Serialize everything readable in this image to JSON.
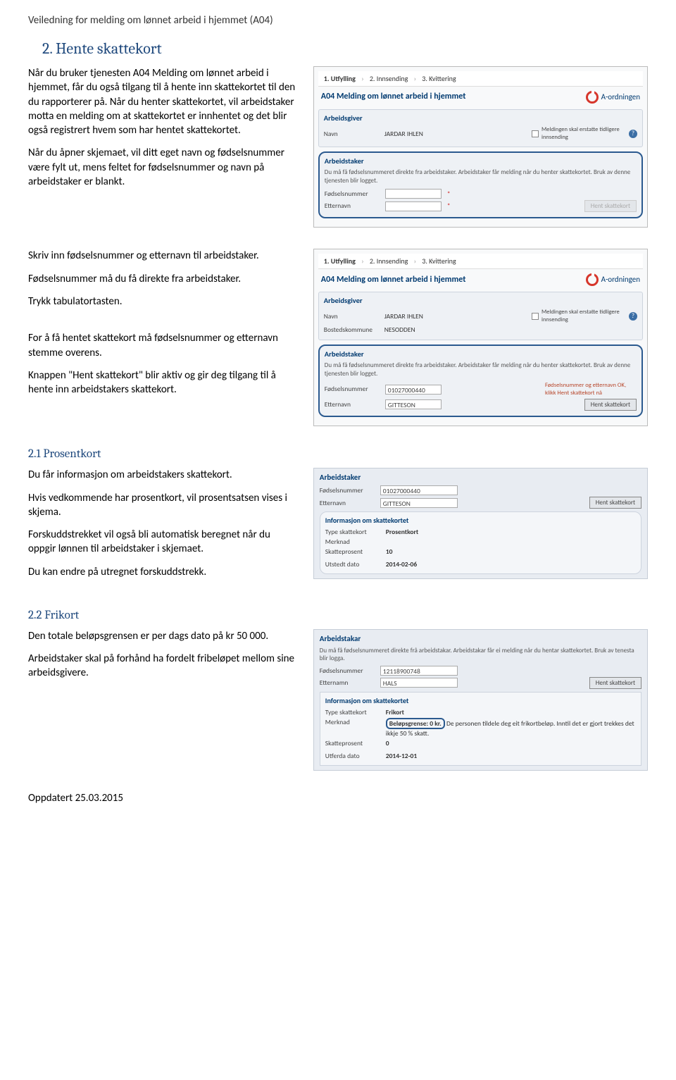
{
  "doc": {
    "title": "Veiledning for melding om lønnet arbeid i hjemmet (A04)",
    "footer": "Oppdatert 25.03.2015"
  },
  "section2": {
    "heading": "2. Hente skattekort",
    "p1": "Når du bruker tjenesten A04 Melding om lønnet arbeid i hjemmet, får du også tilgang til å hente inn skattekortet til den du rapporterer på. Når du henter skattekortet, vil arbeidstaker motta en melding om at skattekortet er innhentet og det blir også registrert hvem som har hentet skattekortet.",
    "p2": "Når du åpner skjemaet, vil ditt eget navn og fødselsnummer være fylt ut, mens feltet for fødselsnummer og navn på arbeidstaker er blankt.",
    "p3a": "Skriv inn fødselsnummer og etternavn til arbeidstaker.",
    "p3b": "Fødselsnummer må du få direkte fra arbeidstaker.",
    "p3c": "Trykk tabulatortasten.",
    "p4a": "For å få hentet skattekort må fødselsnummer og etternavn stemme overens.",
    "p4b": "Knappen \"Hent skattekort\" blir aktiv og gir deg tilgang til å hente inn arbeidstakers skattekort."
  },
  "section21": {
    "heading": "2.1 Prosentkort",
    "p1": "Du får informasjon om arbeidstakers skattekort.",
    "p2": "Hvis vedkommende har prosentkort, vil prosentsatsen vises i skjema.",
    "p3": "Forskuddstrekket vil også bli automatisk beregnet når du oppgir lønnen til arbeidstaker i skjemaet.",
    "p4": "Du kan endre på utregnet forskuddstrekk."
  },
  "section22": {
    "heading": "2.2 Frikort",
    "p1": "Den totale beløpsgrensen er per dags dato på kr 50 000.",
    "p2": "Arbeidstaker skal på forhånd ha fordelt fribeløpet mellom sine arbeidsgivere."
  },
  "shot": {
    "steps": {
      "s1": "1. Utfylling",
      "s2": "2. Innsending",
      "s3": "3. Kvittering"
    },
    "form_title": "A04 Melding om lønnet arbeid i hjemmet",
    "brand": "A-ordningen",
    "arbeidsgiver": "Arbeidsgiver",
    "arbeidstaker": "Arbeidstaker",
    "arbeidstakar_nn": "Arbeidstakar",
    "navn": "Navn",
    "bosted": "Bostedskommune",
    "navn_val": "JARDAR IHLEN",
    "bosted_val": "NESODDEN",
    "checkbox_label": "Meldingen skal erstatte tidligere innsending",
    "note_text": "Du må få fødselsnummeret direkte fra arbeidstaker. Arbeidstaker får melding når du henter skattekortet. Bruk av denne tjenesten blir logget.",
    "note_text_nn": "Du må få fødselsnummeret direkte frå arbeidstakar. Arbeidstakar får ei melding når du hentar skattekortet. Bruk av tenesta blir logga.",
    "fnr": "Fødselsnummer",
    "etternavn": "Etternavn",
    "etternamn_nn": "Etternamn",
    "hent_btn": "Hent skattekort",
    "ok_note": "Fødselsnummer og etternavn OK, klikk Hent skattekort nå",
    "fnr_val": "01027000440",
    "ett_val": "GITTESON",
    "info_title": "Informasjon om skattekortet",
    "type_label": "Type skattekort",
    "type_prosent": "Prosentkort",
    "type_frikort": "Frikort",
    "merknad": "Merknad",
    "skatteprosent": "Skatteprosent",
    "prosent_val": "10",
    "utstedt": "Utstedt dato",
    "utstedt_val": "2014-02-06",
    "frikort_fnr": "12118900748",
    "frikort_ett": "HALS",
    "frikort_merknad_lead": "Beløpsgrense: 0 kr.",
    "frikort_merknad_rest": "De personen tildele deg eit frikortbeløp. Inntil det er gjort trekkes det ikkje 50 % skatt.",
    "frikort_prosent": "0",
    "utferda": "Utferda dato",
    "utferda_val": "2014-12-01"
  }
}
